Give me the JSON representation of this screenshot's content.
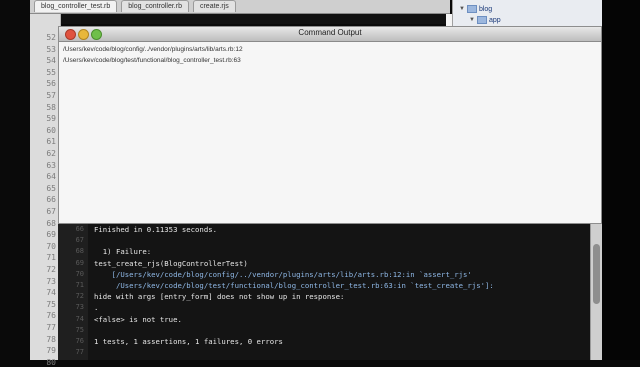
{
  "editor": {
    "tabs": [
      "blog_controller_test.rb",
      "blog_controller.rb",
      "create.rjs"
    ],
    "line_numbers": [
      "52",
      "53",
      "54",
      "55",
      "56",
      "57",
      "58",
      "59",
      "60",
      "61",
      "62",
      "63",
      "64",
      "65",
      "66",
      "67",
      "68",
      "69",
      "70",
      "71",
      "72",
      "73",
      "74",
      "75",
      "76",
      "77",
      "78",
      "79",
      "80"
    ]
  },
  "drawer": {
    "items": [
      {
        "label": "blog",
        "indent": 0
      },
      {
        "label": "app",
        "indent": 1
      }
    ]
  },
  "command_output": {
    "title": "Command Output",
    "lines": [
      "/Users/kev/code/blog/config/../vendor/plugins/arts/lib/arts.rb:12",
      "/Users/kev/code/blog/test/functional/blog_controller_test.rb:63"
    ]
  },
  "terminal": {
    "line_numbers": [
      "66",
      "67",
      "68",
      "69",
      "70",
      "71",
      "72",
      "73",
      "74",
      "75",
      "76",
      "77"
    ],
    "lines": [
      "Finished in 0.11353 seconds.",
      "",
      "  1) Failure:",
      "test_create_rjs(BlogControllerTest)",
      "    [/Users/kev/code/blog/config/../vendor/plugins/arts/lib/arts.rb:12:in `assert_rjs'",
      "     /Users/kev/code/blog/test/functional/blog_controller_test.rb:63:in `test_create_rjs']:",
      "hide with args [entry_form] does not show up in response:",
      ".",
      "<false> is not true.",
      "",
      "1 tests, 1 assertions, 1 failures, 0 errors",
      ""
    ]
  }
}
